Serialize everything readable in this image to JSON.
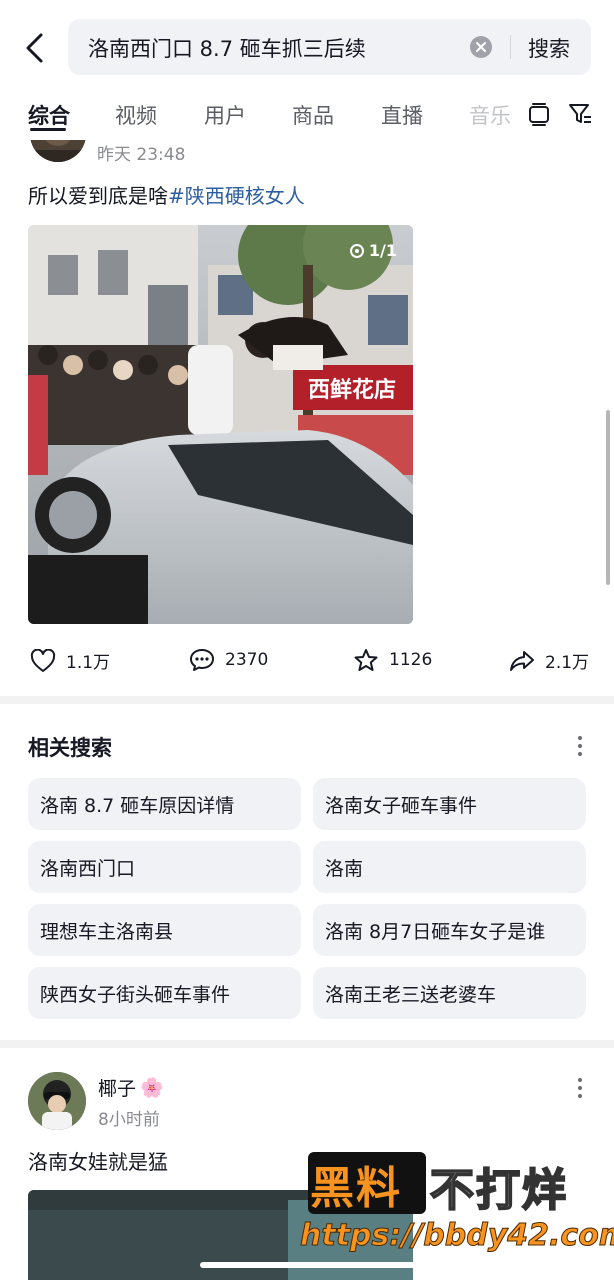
{
  "search": {
    "query": "洛南西门口 8.7 砸车抓三后续",
    "submit_label": "搜索"
  },
  "tabs": [
    {
      "label": "综合",
      "active": true
    },
    {
      "label": "视频"
    },
    {
      "label": "用户"
    },
    {
      "label": "商品"
    },
    {
      "label": "直播"
    },
    {
      "label": "音乐"
    }
  ],
  "post1": {
    "time": "昨天 23:48",
    "text": "所以爱到底是啥",
    "hashtag": "#陕西硬核女人",
    "image_counter": "1/1",
    "image_sign": "西鲜花店",
    "likes": "1.1万",
    "comments": "2370",
    "favorites": "1126",
    "shares": "2.1万"
  },
  "related": {
    "title": "相关搜索",
    "items": [
      "洛南 8.7 砸车原因详情",
      "洛南女子砸车事件",
      "洛南西门口",
      "洛南",
      "理想车主洛南县",
      "洛南 8月7日砸车女子是谁",
      "陕西女子街头砸车事件",
      "洛南王老三送老婆车"
    ]
  },
  "post2": {
    "user_name": "椰子",
    "emoji": "🌸",
    "time": "8小时前",
    "text": "洛南女娃就是猛"
  },
  "watermark": {
    "brand": "黑料",
    "slogan": "不打烊",
    "url": "https://bbdy42.com"
  },
  "colors": {
    "hashtag": "#2c5ea0",
    "watermark_orange": "#f7931e"
  }
}
